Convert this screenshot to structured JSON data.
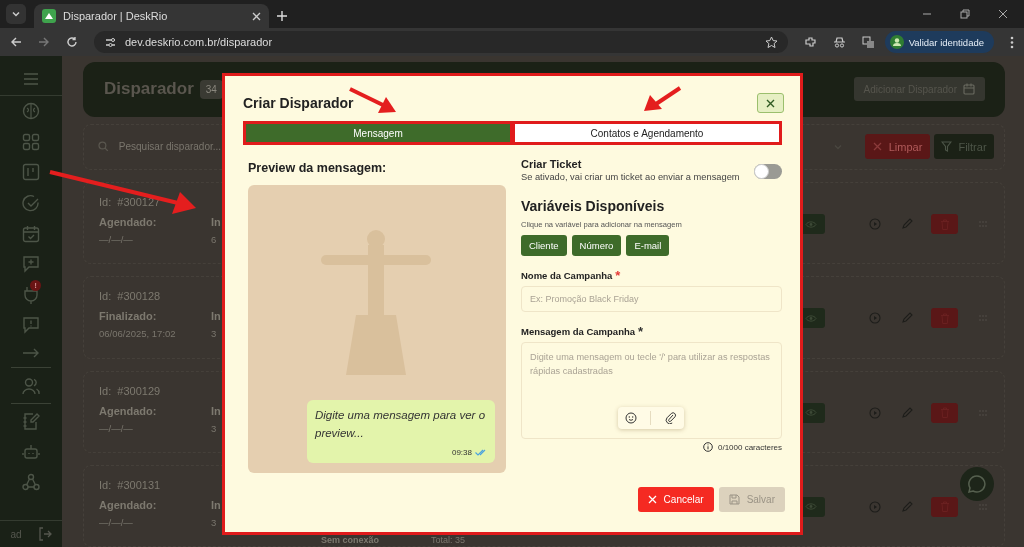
{
  "browser": {
    "tab": {
      "title": "Disparador | DeskRio",
      "selected": true
    },
    "url": "dev.deskrio.com.br/disparador",
    "profile_button": "Validar identidade"
  },
  "sidebar": {
    "alert_badge": "!",
    "user": "ad"
  },
  "page": {
    "title": "Disparador",
    "count": "34",
    "add_button": "Adicionar Disparador",
    "search": {
      "placeholder": "Pesquisar disparador..."
    },
    "clear_button": "Limpar",
    "filter_button": "Filtrar",
    "cards": [
      {
        "id": "Id:  #300127",
        "status": "Agendado:",
        "date": "—/—/—",
        "column_2_label": "In",
        "column_2_value": "6"
      },
      {
        "id": "Id:  #300128",
        "status": "Finalizado:",
        "date": "06/06/2025, 17:02",
        "column_2_label": "In",
        "column_2_value": "3"
      },
      {
        "id": "Id:  #300129",
        "status": "Agendado:",
        "date": "—/—/—",
        "column_2_label": "In",
        "column_2_value": "3"
      },
      {
        "id": "Id:  #300131",
        "status": "Agendado:",
        "date": "—/—/—",
        "column_2_label": "In",
        "column_2_value": "3",
        "column_3": "Sem conexão",
        "column_4": "Total: 35"
      }
    ]
  },
  "dialog": {
    "title": "Criar Disparador",
    "tabs": [
      {
        "label": "Mensagem",
        "selected": true
      },
      {
        "label": "Contatos e Agendamento",
        "selected": false
      }
    ],
    "preview": {
      "heading": "Preview da mensagem:",
      "bubble_text": "Digite uma mensagem para ver o preview...",
      "time": "09:38"
    },
    "ticket": {
      "label": "Criar Ticket",
      "description": "Se ativado, vai criar um ticket ao enviar a mensagem",
      "on": false
    },
    "variables": {
      "heading": "Variáveis Disponíveis",
      "hint": "Clique na variável para adicionar na mensagem",
      "chips": [
        "Cliente",
        "Número",
        "E-mail"
      ]
    },
    "fields": [
      {
        "kind": "input",
        "label": "Nome da Campanha",
        "required_mark": "*",
        "color": "#e53935",
        "placeholder": "Ex: Promoção Black Friday"
      },
      {
        "kind": "textarea",
        "label": "Mensagem da Campanha",
        "required_mark": "*",
        "color": "#333333",
        "placeholder": "Digite uma mensagem ou tecle '/' para utilizar as respostas rápidas cadastradas",
        "counter": "0/1000 caracteres"
      }
    ],
    "buttons": [
      {
        "label": "Cancelar",
        "kind": "cancel",
        "disabled": false
      },
      {
        "label": "Salvar",
        "kind": "save",
        "disabled": true
      }
    ]
  }
}
